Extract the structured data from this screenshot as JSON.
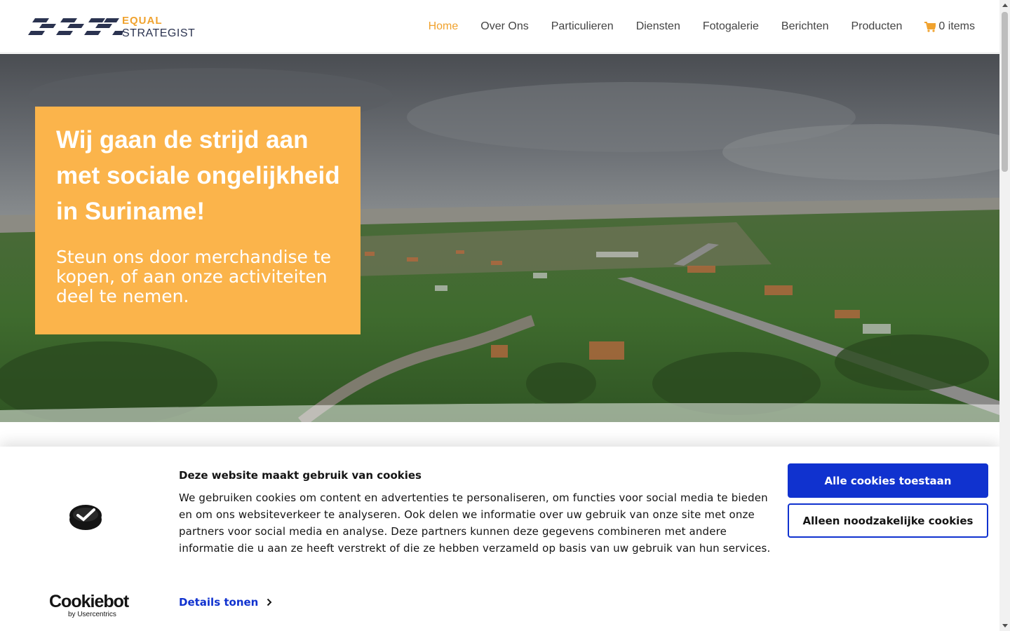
{
  "logo": {
    "line1": "EQUAL",
    "line2": "STRATEGIST",
    "accent_color": "#f0a22e",
    "dark_color": "#2b3350"
  },
  "nav": {
    "items": [
      {
        "label": "Home",
        "active": true
      },
      {
        "label": "Over Ons"
      },
      {
        "label": "Particulieren"
      },
      {
        "label": "Diensten"
      },
      {
        "label": "Fotogalerie"
      },
      {
        "label": "Berichten"
      },
      {
        "label": "Producten"
      }
    ],
    "cart": {
      "icon": "cart-icon",
      "label": "0 items"
    }
  },
  "hero": {
    "title": "Wij gaan de strijd aan met sociale ongelijkheid in Suriname!",
    "subtitle": "Steun ons door merchandise te kopen, of aan onze activiteiten deel te nemen.",
    "box_color": "#fbb44b"
  },
  "cookie": {
    "brand": "Cookiebot",
    "brand_by": "by Usercentrics",
    "title": "Deze website maakt gebruik van cookies",
    "text": "We gebruiken cookies om content en advertenties te personaliseren, om functies voor social media te bieden en om ons websiteverkeer te analyseren. Ook delen we informatie over uw gebruik van onze site met onze partners voor social media en analyse. Deze partners kunnen deze gegevens combineren met andere informatie die u aan ze heeft verstrekt of die ze hebben verzameld op basis van uw gebruik van hun services.",
    "details_label": "Details tonen",
    "allow_all_label": "Alle cookies toestaan",
    "necessary_only_label": "Alleen noodzakelijke cookies",
    "accent_color": "#1032cf"
  }
}
